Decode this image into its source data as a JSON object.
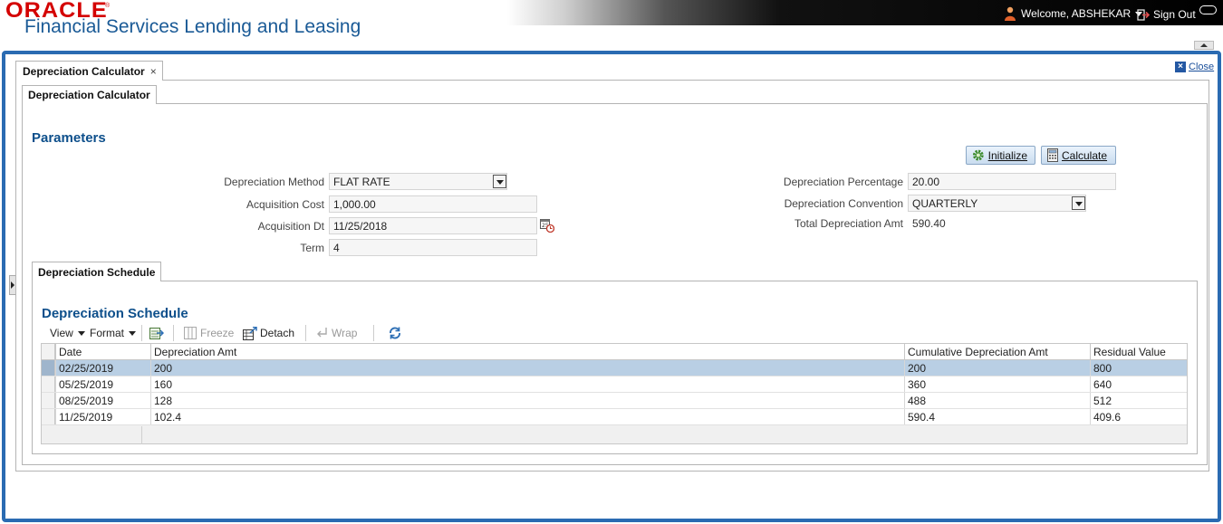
{
  "header": {
    "brand": "ORACLE",
    "app_title": "Financial Services Lending and Leasing",
    "welcome": "Welcome, ABSHEKAR",
    "sign_out": "Sign Out"
  },
  "page_tab": {
    "label": "Depreciation Calculator",
    "close_glyph": "×"
  },
  "close_link": "Close",
  "inner_tab": "Depreciation Calculator",
  "parameters": {
    "title": "Parameters",
    "buttons": {
      "initialize": "Initialize",
      "calculate": "Calculate"
    },
    "fields": {
      "depreciation_method": {
        "label": "Depreciation Method",
        "value": "FLAT RATE"
      },
      "acquisition_cost": {
        "label": "Acquisition Cost",
        "value": "1,000.00"
      },
      "acquisition_dt": {
        "label": "Acquisition Dt",
        "value": "11/25/2018"
      },
      "term": {
        "label": "Term",
        "value": "4"
      },
      "depreciation_percentage": {
        "label": "Depreciation Percentage",
        "value": "20.00"
      },
      "depreciation_convention": {
        "label": "Depreciation Convention",
        "value": "QUARTERLY"
      },
      "total_depreciation_amt": {
        "label": "Total Depreciation Amt",
        "value": "590.40"
      }
    }
  },
  "schedule": {
    "tab": "Depreciation Schedule",
    "title": "Depreciation Schedule",
    "toolbar": {
      "view": "View",
      "format": "Format",
      "freeze": "Freeze",
      "detach": "Detach",
      "wrap": "Wrap"
    },
    "columns": [
      "Date",
      "Depreciation Amt",
      "Cumulative Depreciation Amt",
      "Residual Value"
    ],
    "rows": [
      [
        "02/25/2019",
        "200",
        "200",
        "800"
      ],
      [
        "05/25/2019",
        "160",
        "360",
        "640"
      ],
      [
        "08/25/2019",
        "128",
        "488",
        "512"
      ],
      [
        "11/25/2019",
        "102.4",
        "590.4",
        "409.6"
      ]
    ]
  },
  "icons": {
    "user": "user-icon",
    "sign_out": "sign-out-icon",
    "initialize": "gear-icon",
    "calculate": "calculator-icon",
    "calendar": "calendar-icon",
    "export": "export-icon",
    "refresh": "refresh-icon"
  },
  "colors": {
    "brand_red": "#d40000",
    "title_blue": "#1a5a96",
    "frame_blue": "#2a6bb2",
    "selected_row": "#b9cfe4"
  }
}
